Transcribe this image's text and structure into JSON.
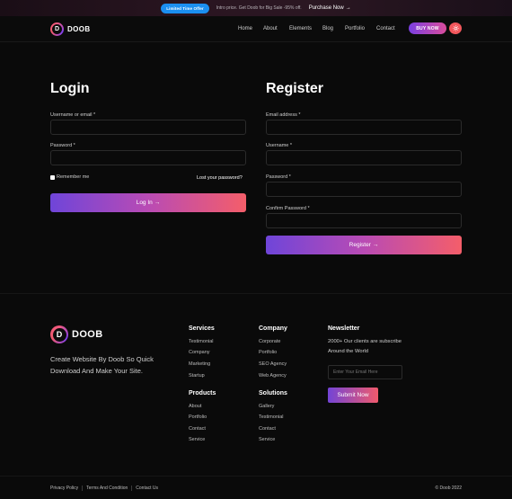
{
  "topbar": {
    "badge": "Limited Time Offer",
    "promo": "Intro price. Get Doob for Big Sale -95% off.",
    "purchase": "Purchase Now"
  },
  "header": {
    "logo_mark": "D",
    "logo_text": "DOOB",
    "nav": [
      "Home",
      "About",
      "Elements",
      "Blog",
      "Portfolio",
      "Contact"
    ],
    "buy_now": "BUY NOW",
    "theme_icon": "sun-icon"
  },
  "login": {
    "title": "Login",
    "username_label": "Username or email *",
    "password_label": "Password *",
    "remember": "Remember me",
    "lost_password": "Lost your password?",
    "button": "Log In"
  },
  "register": {
    "title": "Register",
    "email_label": "Email address *",
    "username_label": "Username *",
    "password_label": "Password *",
    "confirm_label": "Confirm Password *",
    "button": "Register"
  },
  "footer": {
    "logo_text": "DOOB",
    "tagline": "Create Website By Doob So Quick Download And Make Your Site.",
    "services": {
      "title": "Services",
      "links": [
        "Testimonial",
        "Company",
        "Marketing",
        "Startup"
      ]
    },
    "company": {
      "title": "Company",
      "links": [
        "Corporate",
        "Portfolio",
        "SEO Agency",
        "Web Agency"
      ]
    },
    "products": {
      "title": "Products",
      "links": [
        "About",
        "Portfolio",
        "Contact",
        "Service"
      ]
    },
    "solutions": {
      "title": "Solutions",
      "links": [
        "Gallery",
        "Testimonial",
        "Contact",
        "Service"
      ]
    },
    "newsletter": {
      "title": "Newsletter",
      "text": "2000+ Our clients are subscribe Around the World",
      "placeholder": "Enter Your Email Here",
      "button": "Submit Now"
    }
  },
  "bottom": {
    "links": [
      "Privacy Policy",
      "Terms And Condition",
      "Contact Us"
    ],
    "copyright": "© Doob 2022"
  },
  "colors": {
    "accent_purple": "#7344d6",
    "accent_pink": "#f05a6c",
    "badge_blue": "#1b8ff0"
  }
}
